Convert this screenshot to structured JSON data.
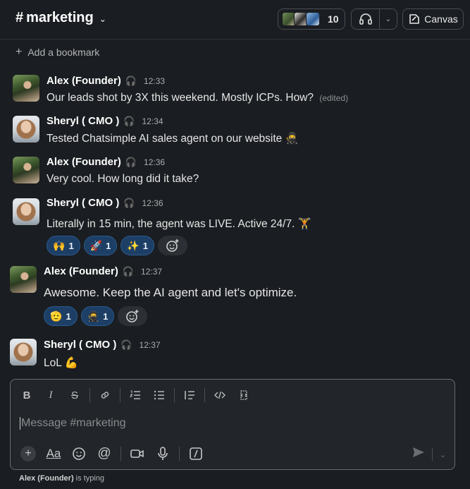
{
  "header": {
    "channel_hash": "#",
    "channel_name": "marketing",
    "member_count": "10",
    "canvas_label": "Canvas"
  },
  "bookmark": {
    "label": "Add a bookmark"
  },
  "messages": [
    {
      "author": "Alex (Founder)",
      "time": "12:33",
      "text": "Our leads shot by 3X this weekend. Mostly ICPs. How?",
      "edited": "(edited)"
    },
    {
      "author": "Sheryl ( CMO )",
      "time": "12:34",
      "text": "Tested Chatsimple AI sales agent on our website",
      "emoji": "🥷"
    },
    {
      "author": "Alex (Founder)",
      "time": "12:36",
      "text": "Very cool. How long did it take?"
    },
    {
      "author": "Sheryl ( CMO )",
      "time": "12:36",
      "text": "Literally in 15 min, the agent was LIVE. Active 24/7.",
      "emoji": "🏋",
      "reactions": [
        {
          "emoji": "🙌",
          "count": "1"
        },
        {
          "emoji": "🚀",
          "count": "1"
        },
        {
          "emoji": "✨",
          "count": "1"
        }
      ]
    },
    {
      "author": "Alex (Founder)",
      "time": "12:37",
      "text": "Awesome. Keep the AI agent and let's optimize.",
      "reactions": [
        {
          "emoji": "🫡",
          "count": "1"
        },
        {
          "emoji": "🥷",
          "count": "1"
        }
      ]
    },
    {
      "author": "Sheryl ( CMO )",
      "time": "12:37",
      "text": "LoL",
      "emoji": "💪"
    }
  ],
  "composer": {
    "placeholder": "Message #marketing",
    "aa_label": "Aa"
  },
  "typing": {
    "who": "Alex (Founder)",
    "suffix": " is typing"
  }
}
